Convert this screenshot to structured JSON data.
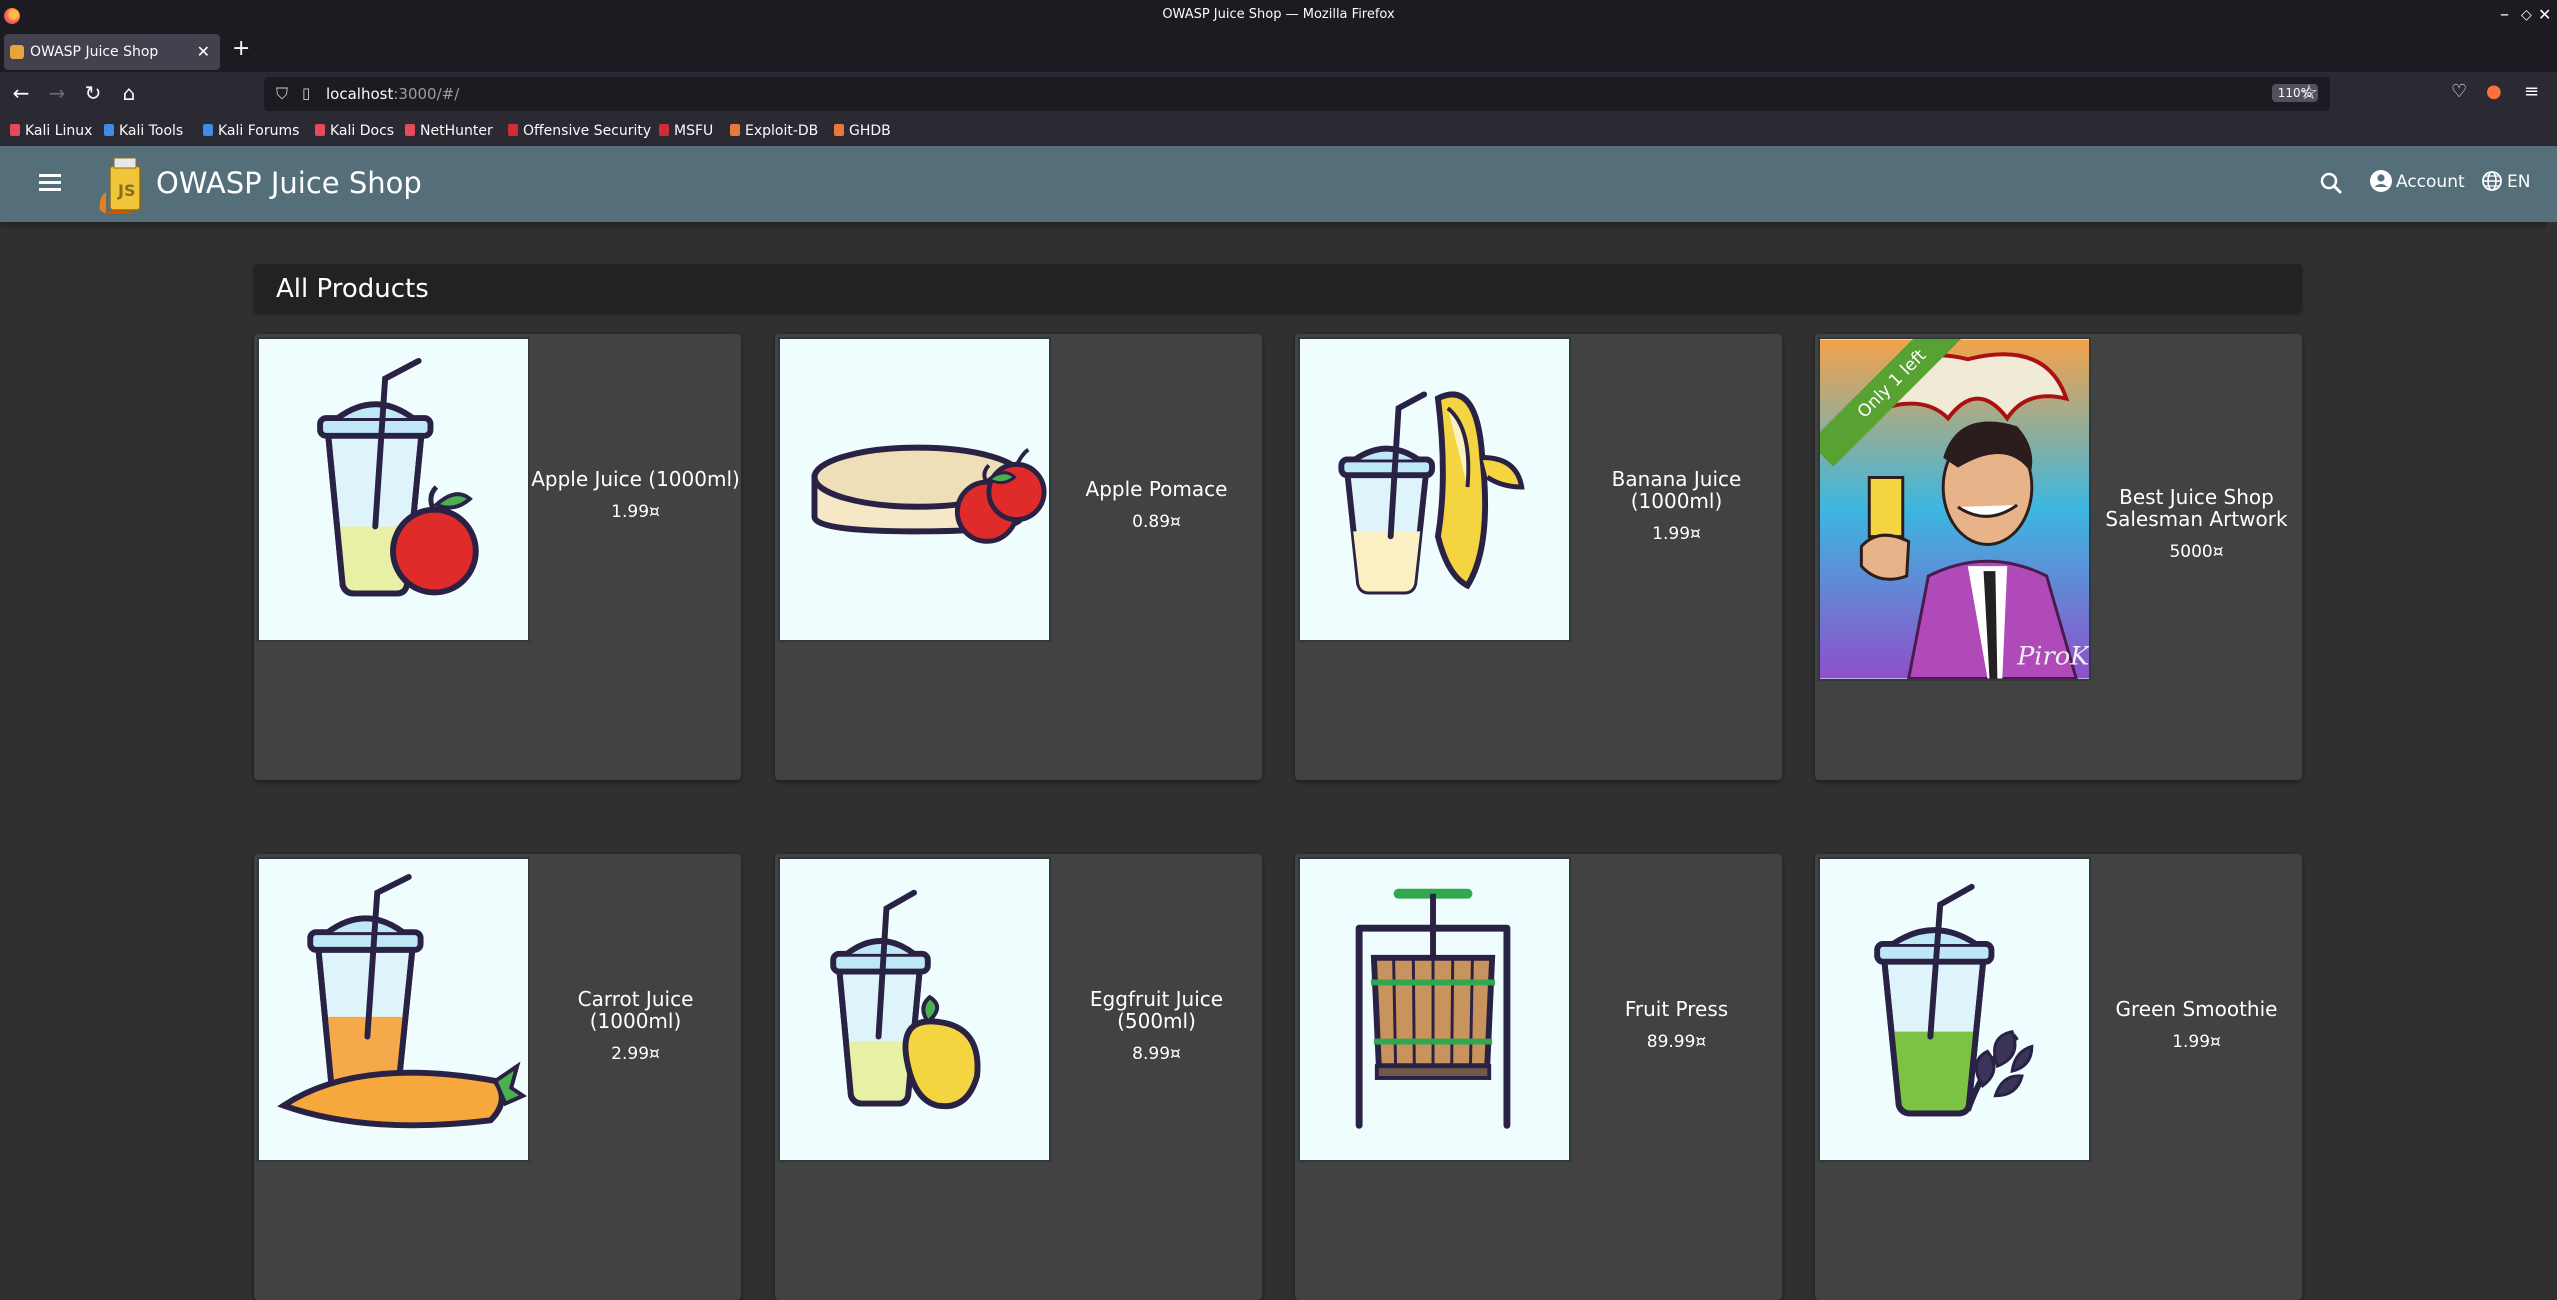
{
  "window": {
    "title": "OWASP Juice Shop — Mozilla Firefox"
  },
  "tab": {
    "title": "OWASP Juice Shop"
  },
  "urlbar": {
    "host": "localhost",
    "path": ":3000/#/",
    "zoom": "110%"
  },
  "bookmarks": [
    {
      "label": "Kali Linux",
      "color": "#e8485b"
    },
    {
      "label": "Kali Tools",
      "color": "#3e8de5"
    },
    {
      "label": "Kali Forums",
      "color": "#3e8de5"
    },
    {
      "label": "Kali Docs",
      "color": "#e8485b"
    },
    {
      "label": "NetHunter",
      "color": "#e8485b"
    },
    {
      "label": "Offensive Security",
      "color": "#d12c33"
    },
    {
      "label": "MSFU",
      "color": "#d12c33"
    },
    {
      "label": "Exploit-DB",
      "color": "#e9763b"
    },
    {
      "label": "GHDB",
      "color": "#e9763b"
    }
  ],
  "app": {
    "title": "OWASP Juice Shop",
    "account_label": "Account",
    "language_label": "EN",
    "toolbar_color": "#546e7a"
  },
  "section": {
    "title": "All Products"
  },
  "products": [
    {
      "name": "Apple Juice (1000ml)",
      "price": "1.99¤",
      "icon": "apple-juice-icon"
    },
    {
      "name": "Apple Pomace",
      "price": "0.89¤",
      "icon": "apple-pomace-icon"
    },
    {
      "name": "Banana Juice (1000ml)",
      "price": "1.99¤",
      "icon": "banana-juice-icon"
    },
    {
      "name": "Best Juice Shop Salesman Artwork",
      "price": "5000¤",
      "icon": "salesman-artwork-icon",
      "badge": "Only 1 left"
    },
    {
      "name": "Carrot Juice (1000ml)",
      "price": "2.99¤",
      "icon": "carrot-juice-icon"
    },
    {
      "name": "Eggfruit Juice (500ml)",
      "price": "8.99¤",
      "icon": "eggfruit-juice-icon"
    },
    {
      "name": "Fruit Press",
      "price": "89.99¤",
      "icon": "fruit-press-icon"
    },
    {
      "name": "Green Smoothie",
      "price": "1.99¤",
      "icon": "green-smoothie-icon"
    }
  ]
}
